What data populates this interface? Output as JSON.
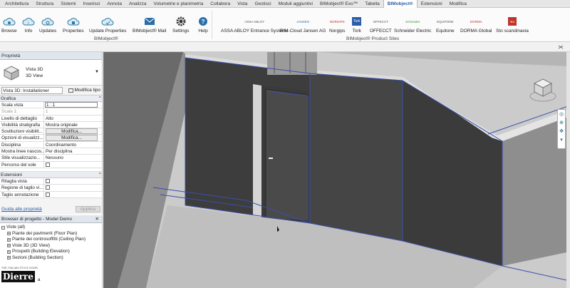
{
  "ribbon_tabs": [
    "Architettura",
    "Struttura",
    "Sistemi",
    "Inserisci",
    "Annota",
    "Analizza",
    "Volumetrie e planimetria",
    "Collabora",
    "Vista",
    "Gestisci",
    "Moduli aggiuntivi",
    "BIMobject® Exo™",
    "Tabella",
    "BIMobject®",
    "Estensioni",
    "Modifica"
  ],
  "active_tab": "BIMobject®",
  "ribbon": {
    "buttons": {
      "browse": "Browse",
      "info": "Info",
      "updates": "Updates",
      "properties": "Properties",
      "update_properties": "Update Properties",
      "mail": "BIMobject® Mail",
      "settings": "Settings",
      "help": "Help"
    },
    "group_label": "BIMobject®",
    "sites": {
      "assa": "ASSA ABLOY Entrance Systems",
      "jansen": "BIM-Cloud Jansen AG",
      "norgips": "Norgips",
      "tork": "Tork",
      "offecct": "OFFECCT",
      "schneider": "Schneider Electric",
      "equitone": "Equitone",
      "dorma": "DORMA Global",
      "sto": "Sto scandinavia"
    },
    "logos": {
      "assa": "ASSA ABLOY",
      "jansen": "JANSEN",
      "norgips": "NORGIPS",
      "tork": "Tork",
      "offecct": "OFFECCT",
      "schneider": "Schneider",
      "equitone": "EQUITONE",
      "dorma": "DORMA",
      "sto": "sto"
    },
    "sites_group_label": "BIMobject® Product Sites"
  },
  "properties": {
    "title": "Proprietà",
    "type_name": "Vista 3D",
    "type_sub": "3D View",
    "view_select": "Vista 3D: Installationer",
    "edit_type": "Modifica tipo",
    "sec_grafica": "Grafica",
    "rows": {
      "scala_vista": [
        "Scala vista",
        "1 : 1"
      ],
      "scala": [
        "Scala 1:",
        "1"
      ],
      "livello": [
        "Livello di dettaglio",
        "Alto"
      ],
      "visibilita": [
        "Visibilità stratigrafia",
        "Mostra originale"
      ],
      "sostituzioni": [
        "Sostituzioni visibilit...",
        "Modifica..."
      ],
      "opzioni": [
        "Opzioni di visualizz...",
        "Modifica..."
      ],
      "disciplina": [
        "Disciplina",
        "Coordinamento"
      ],
      "mostra": [
        "Mostra linee nascos...",
        "Per disciplina"
      ],
      "stile": [
        "Stile visualizzazio...",
        "Nessuno"
      ],
      "percorso": [
        "Percorso del sole",
        ""
      ]
    },
    "sec_estensioni": "Estensioni",
    "ext_rows": {
      "ritaglia": "Ritaglia vista",
      "regione": "Regione di taglio vi...",
      "taglio": "Taglio annotazione"
    },
    "help_link": "Guida alle proprietà",
    "apply": "Applica"
  },
  "browser": {
    "title": "Browser di progetto - Model Demo",
    "close": "✕",
    "items": [
      "Viste (all)",
      "Piante dei pavimenti (Floor Plan)",
      "Piante dei controsoffitti (Ceiling Plan)",
      "Viste 3D (3D View)",
      "Prospetti (Building Elevation)",
      "Sezioni (Building Section)"
    ]
  },
  "brand": {
    "tagline": "THE ITALIAN STYLE DOOR",
    "name": "Dierre",
    "suffix": "a"
  }
}
